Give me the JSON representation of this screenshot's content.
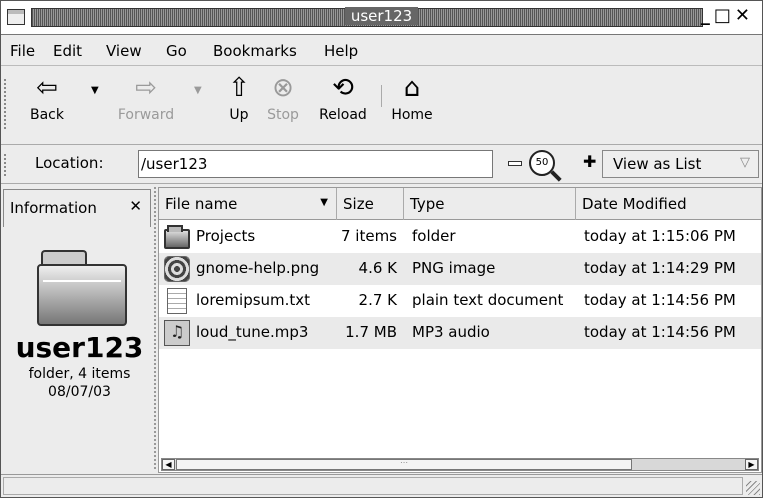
{
  "window": {
    "title": "user123"
  },
  "menu": [
    {
      "label": "File"
    },
    {
      "label": "Edit"
    },
    {
      "label": "View"
    },
    {
      "label": "Go"
    },
    {
      "label": "Bookmarks"
    },
    {
      "label": "Help"
    }
  ],
  "toolbar": {
    "back": "Back",
    "forward": "Forward",
    "up": "Up",
    "stop": "Stop",
    "reload": "Reload",
    "home": "Home"
  },
  "location": {
    "label": "Location:",
    "value": "/user123",
    "zoom_level": "50",
    "view_as": "View as List"
  },
  "sidepane": {
    "header": "Information",
    "name": "user123",
    "type_line": "folder, 4 items",
    "date": "08/07/03"
  },
  "filelist": {
    "columns": [
      "File name",
      "Size",
      "Type",
      "Date Modified"
    ],
    "rows": [
      {
        "name": "Projects",
        "size": "7 items",
        "type": "folder",
        "modified": "today at 1:15:06 PM",
        "icon": "folder-icon"
      },
      {
        "name": "gnome-help.png",
        "size": "4.6 K",
        "type": "PNG image",
        "modified": "today at 1:14:29 PM",
        "icon": "image-icon"
      },
      {
        "name": "loremipsum.txt",
        "size": "2.7 K",
        "type": "plain text document",
        "modified": "today at 1:14:56 PM",
        "icon": "text-file-icon"
      },
      {
        "name": "loud_tune.mp3",
        "size": "1.7 MB",
        "type": "MP3 audio",
        "modified": "today at 1:14:56 PM",
        "icon": "audio-file-icon"
      }
    ]
  }
}
